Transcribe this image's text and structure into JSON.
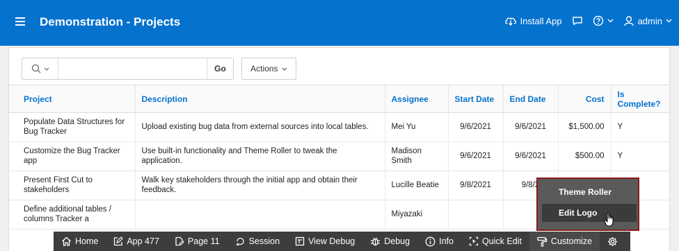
{
  "header": {
    "title": "Demonstration - Projects",
    "install_app": "Install App",
    "user": "admin"
  },
  "toolbar": {
    "search_value": "",
    "go_label": "Go",
    "actions_label": "Actions"
  },
  "table": {
    "columns": [
      "Project",
      "Description",
      "Assignee",
      "Start Date",
      "End Date",
      "Cost",
      "Is Complete?"
    ],
    "rows": [
      [
        "Populate Data Structures for Bug Tracker",
        "Upload existing bug data from external sources into local tables.",
        "Mei Yu",
        "9/6/2021",
        "9/6/2021",
        "$1,500.00",
        "Y"
      ],
      [
        "Customize the Bug Tracker app",
        "Use built-in functionality and Theme Roller to tweak the application.",
        "Madison Smith",
        "9/6/2021",
        "9/6/2021",
        "$500.00",
        "Y"
      ],
      [
        "Present First Cut to stakeholders",
        "Walk key stakeholders through the initial app and obtain their feedback.",
        "Lucille Beatie",
        "9/8/2021",
        "9/8/2",
        "",
        ""
      ],
      [
        "Define additional tables / columns Tracker a",
        "",
        "Miyazaki",
        "",
        "",
        "",
        ""
      ]
    ]
  },
  "menu": {
    "items": [
      "Theme Roller",
      "Edit Logo"
    ]
  },
  "devbar": {
    "home": "Home",
    "app": "App 477",
    "page": "Page 11",
    "session": "Session",
    "view_debug": "View Debug",
    "debug": "Debug",
    "info": "Info",
    "quick_edit": "Quick Edit",
    "customize": "Customize"
  }
}
